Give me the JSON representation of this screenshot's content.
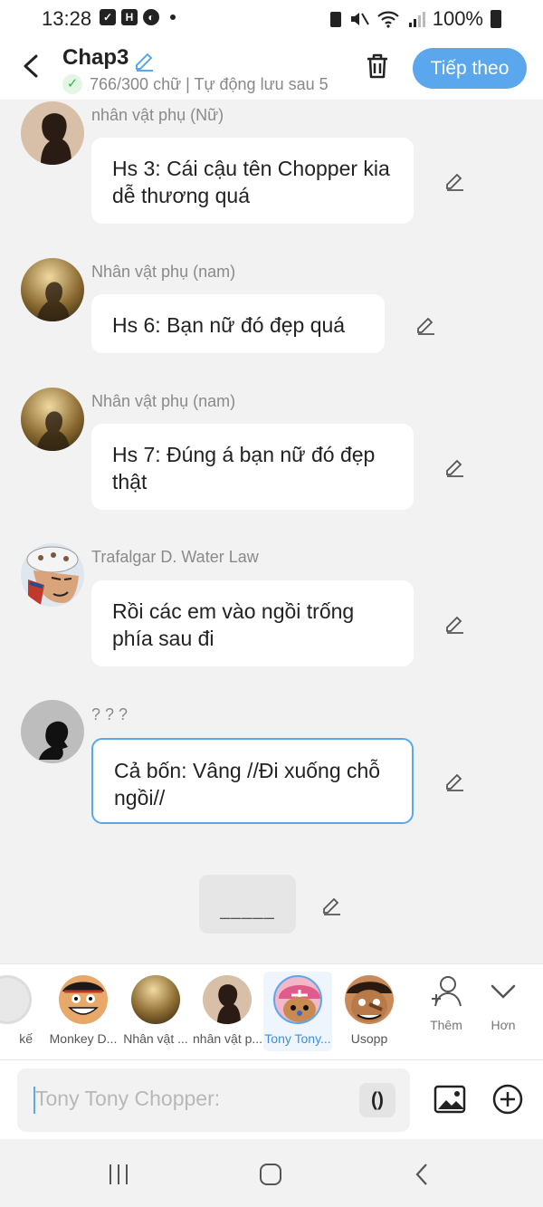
{
  "status_bar": {
    "time": "13:28",
    "battery": "100%"
  },
  "header": {
    "title": "Chap3",
    "autosave": "766/300 chữ | Tự động lưu sau 5",
    "next_label": "Tiếp theo"
  },
  "messages": [
    {
      "speaker": "nhân vật phụ (Nữ)",
      "text": "Hs 3: Cái cậu tên Chopper kia dễ thương quá"
    },
    {
      "speaker": "Nhân vật phụ (nam)",
      "text": "Hs 6: Bạn nữ đó đẹp quá"
    },
    {
      "speaker": "Nhân vật phụ (nam)",
      "text": "Hs 7: Đúng á bạn nữ đó đẹp thật"
    },
    {
      "speaker": "Trafalgar D. Water Law",
      "text": "Rồi các em vào ngồi trống phía sau đi"
    },
    {
      "speaker": "? ? ?",
      "text": "Cả bốn: Vâng //Đi xuống chỗ ngồi//"
    }
  ],
  "narration": {
    "text": "_____"
  },
  "characters": [
    {
      "name": "kế"
    },
    {
      "name": "Monkey D..."
    },
    {
      "name": "Nhân vật ..."
    },
    {
      "name": "nhân vật p..."
    },
    {
      "name": "Tony Tony..."
    },
    {
      "name": "Usopp"
    }
  ],
  "tools": {
    "add_label": "Thêm",
    "more_label": "Hơn"
  },
  "input": {
    "placeholder": "Tony Tony Chopper:",
    "paren_label": "()"
  },
  "colors": {
    "accent": "#5ba7ee",
    "background": "#f2f2f2"
  }
}
